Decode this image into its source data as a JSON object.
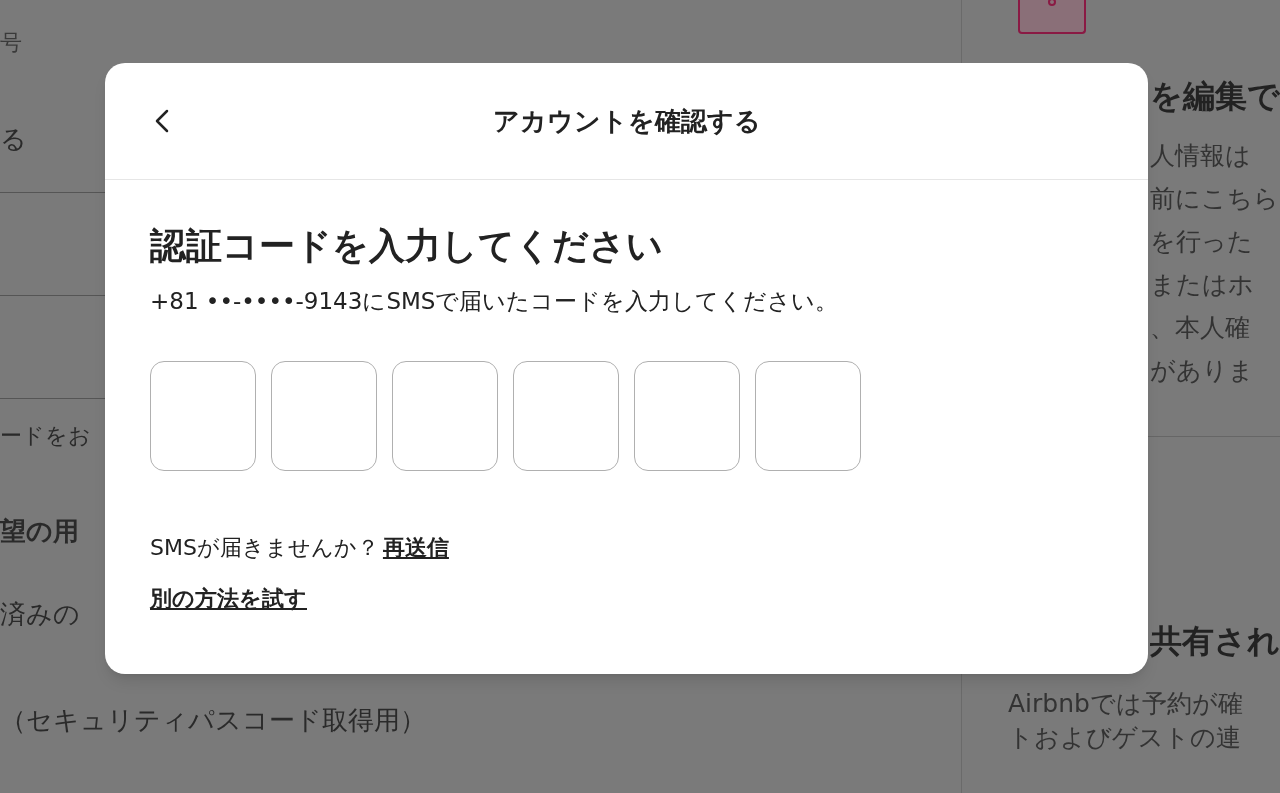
{
  "background": {
    "left_lines": [
      {
        "text": "号",
        "kind": "label"
      },
      {
        "text": "る",
        "kind": "value"
      },
      {
        "kind": "divider"
      },
      {
        "kind": "divider"
      },
      {
        "text": "ードをお",
        "kind": "note"
      },
      {
        "text": "望の用",
        "kind": "heading"
      },
      {
        "text": "済みの",
        "kind": "value"
      },
      {
        "text": "（セキュリティパスコード取得用）",
        "kind": "value"
      }
    ],
    "right_heading": "を編集で",
    "right_lines": [
      "人情報は",
      "前にこちら",
      "を行った",
      "またはホ",
      "、本人確",
      "がありま"
    ],
    "right_heading_2": "共有され",
    "right_lines_2": [
      "Airbnbでは予約が確",
      "トおよびゲストの連"
    ]
  },
  "dialog": {
    "title": "アカウントを確認する",
    "heading": "認証コードを入力してください",
    "message": "+81 ••-••••-9143にSMSで届いたコードを入力してください。",
    "code_inputs": [
      {
        "kind": "digit"
      },
      {
        "kind": "digit"
      },
      {
        "kind": "digit"
      },
      {
        "kind": "digit"
      },
      {
        "kind": "digit"
      },
      {
        "kind": "digit"
      }
    ],
    "resend_prompt": "SMSが届きませんか？",
    "resend_link": "再送信",
    "alternative_link": "別の方法を試す"
  }
}
